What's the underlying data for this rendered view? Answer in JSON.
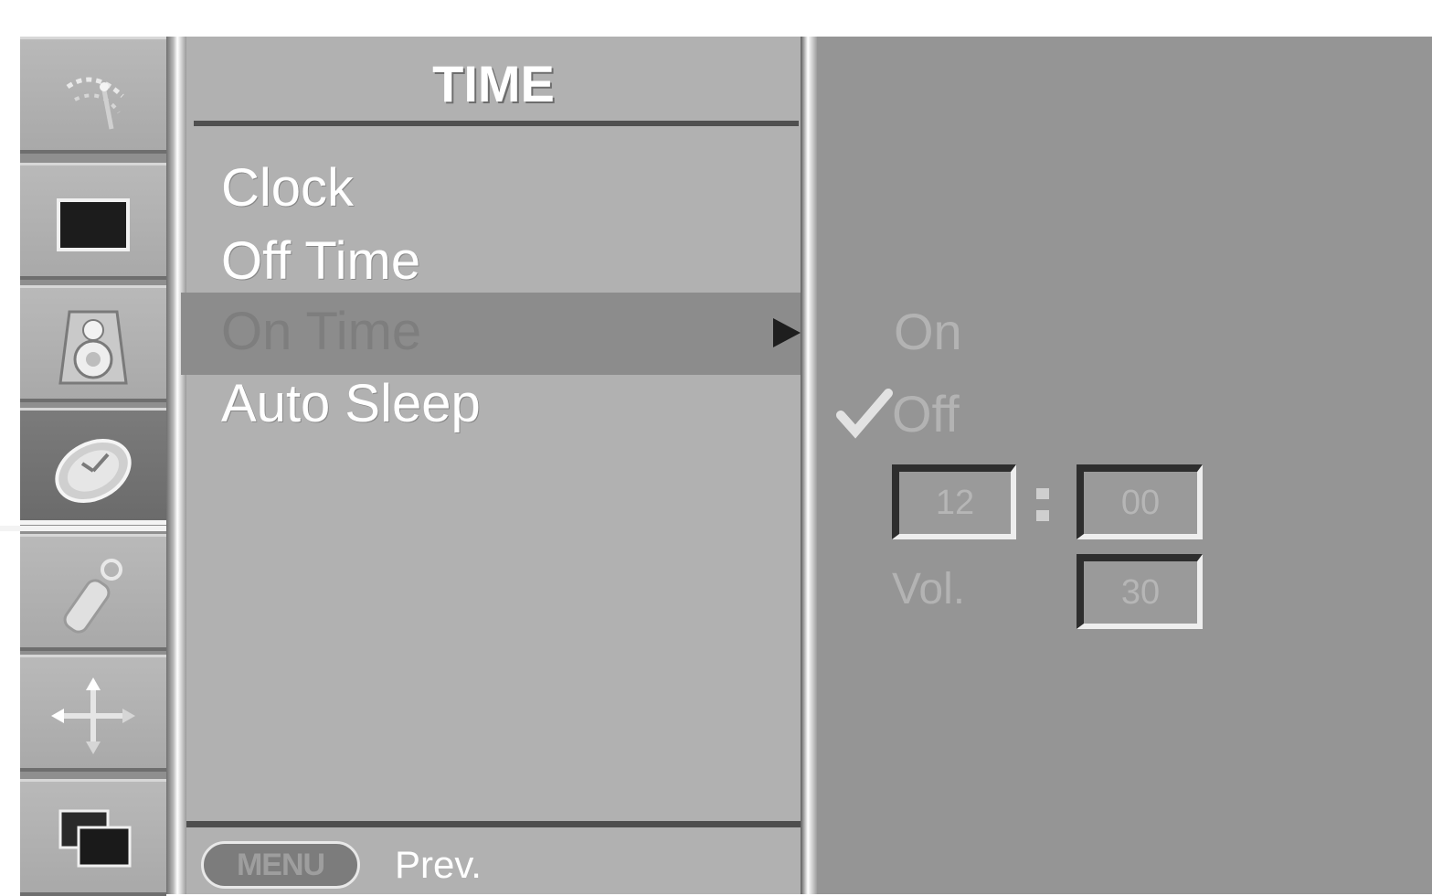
{
  "sidebar": {
    "categories": [
      {
        "name": "setup",
        "icon": "satellite-dish-icon"
      },
      {
        "name": "picture",
        "icon": "picture-screen-icon"
      },
      {
        "name": "audio",
        "icon": "speaker-icon"
      },
      {
        "name": "time",
        "icon": "clock-icon",
        "active": true
      },
      {
        "name": "option",
        "icon": "remote-key-icon"
      },
      {
        "name": "screen",
        "icon": "move-cross-icon"
      },
      {
        "name": "pip",
        "icon": "pip-windows-icon"
      }
    ]
  },
  "menu": {
    "title": "TIME",
    "items": [
      {
        "label": "Clock"
      },
      {
        "label": "Off Time"
      },
      {
        "label": "On Time",
        "selected": true
      },
      {
        "label": "Auto Sleep"
      }
    ],
    "footer": {
      "button_label": "MENU",
      "hint": "Prev."
    }
  },
  "submenu": {
    "options": [
      {
        "label": "On",
        "checked": false
      },
      {
        "label": "Off",
        "checked": true
      }
    ],
    "hour": "12",
    "minute": "00",
    "vol_label": "Vol.",
    "vol_value": "30"
  },
  "colors": {
    "panel_bg": "#b1b1b1",
    "selected_row": "#8c8c8c",
    "submenu_bg": "#959595",
    "title_text": "#ffffff"
  }
}
